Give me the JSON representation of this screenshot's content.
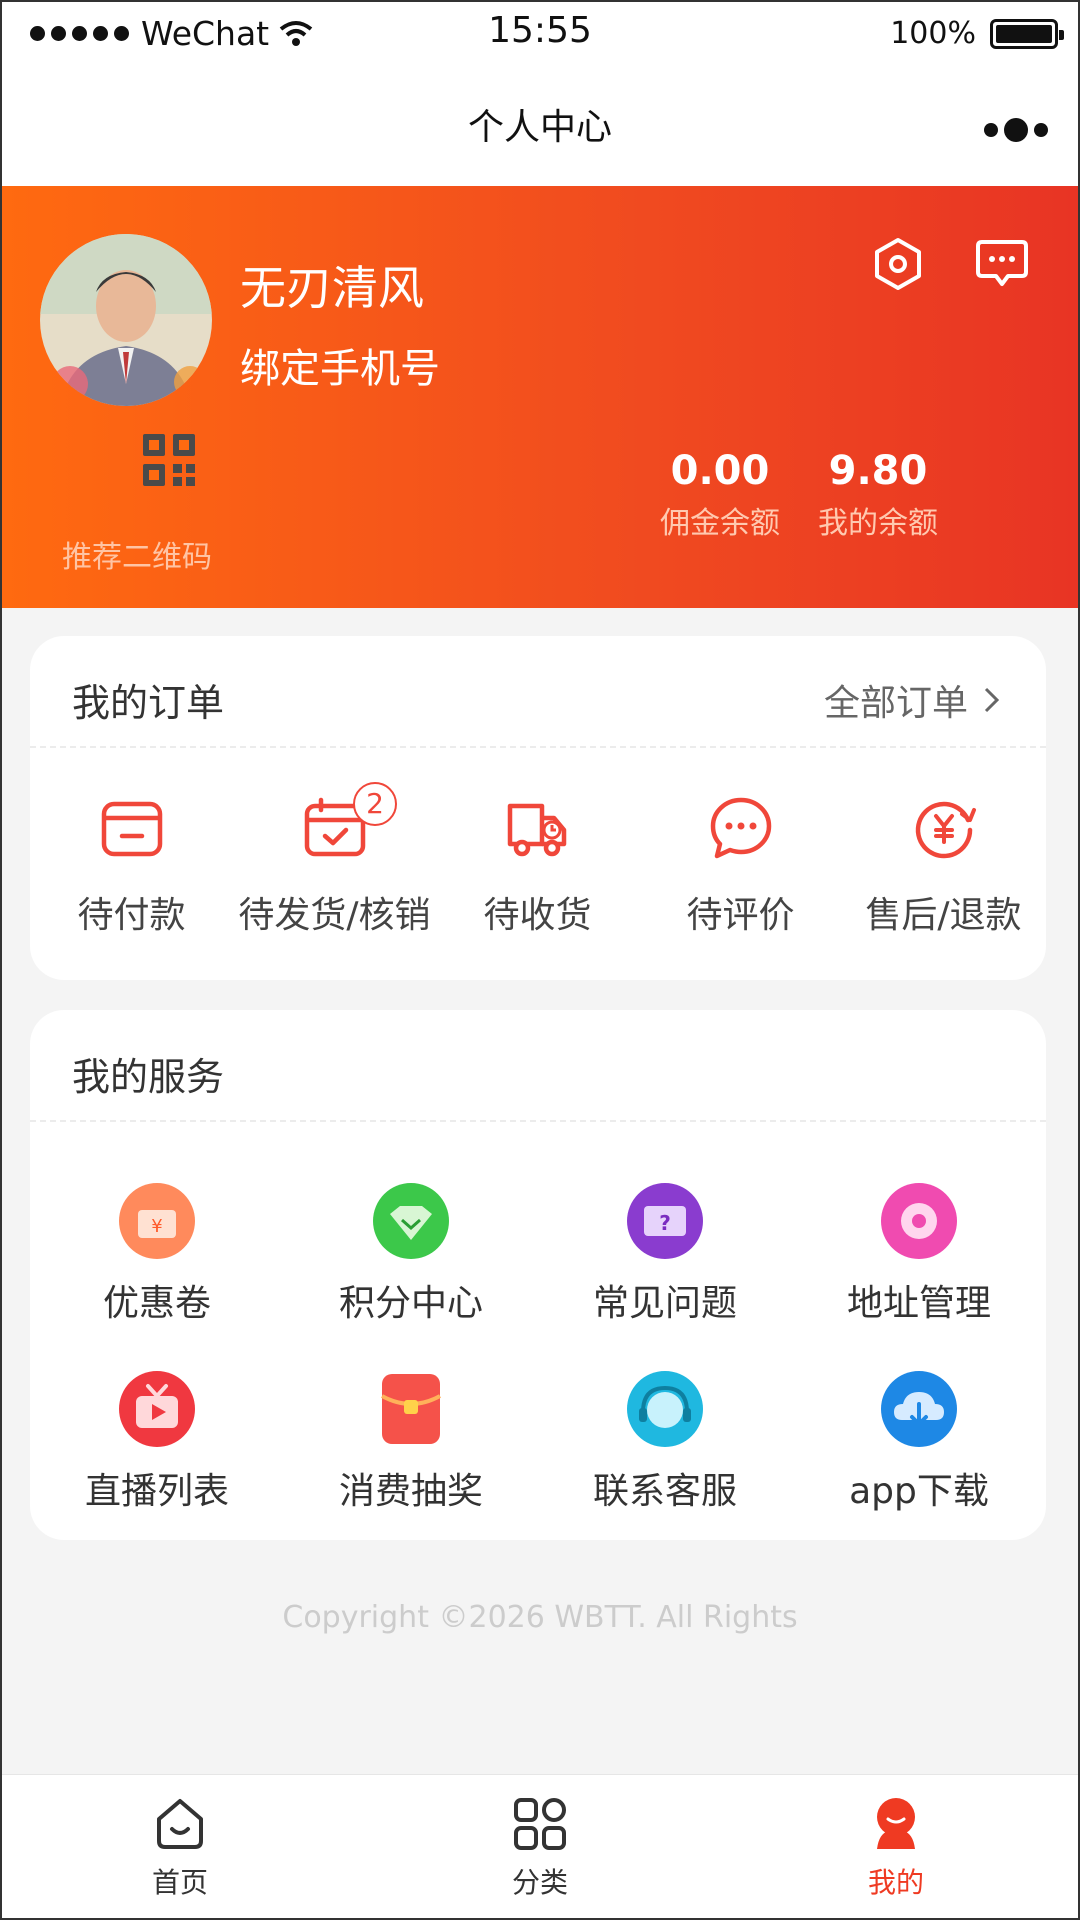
{
  "status_bar": {
    "carrier": "WeChat",
    "time": "15:55",
    "battery": "100%"
  },
  "nav": {
    "title": "个人中心"
  },
  "profile": {
    "username": "无刃清风",
    "bind_phone": "绑定手机号",
    "qr_label": "推荐二维码",
    "balances": [
      {
        "value": "0.00",
        "label": "佣金余额"
      },
      {
        "value": "9.80",
        "label": "我的余额"
      }
    ]
  },
  "orders": {
    "title": "我的订单",
    "more": "全部订单",
    "items": [
      {
        "label": "待付款",
        "icon": "wallet-icon"
      },
      {
        "label": "待发货/核销",
        "icon": "calendar-check-icon",
        "badge": "2"
      },
      {
        "label": "待收货",
        "icon": "delivery-truck-icon"
      },
      {
        "label": "待评价",
        "icon": "chat-bubble-icon"
      },
      {
        "label": "售后/退款",
        "icon": "refund-icon"
      }
    ]
  },
  "services": {
    "title": "我的服务",
    "items": [
      {
        "label": "优惠卷",
        "icon": "coupon-icon",
        "color": "#ff7a4a"
      },
      {
        "label": "积分中心",
        "icon": "points-icon",
        "color": "#3cc84a"
      },
      {
        "label": "常见问题",
        "icon": "faq-icon",
        "color": "#8a3ccf"
      },
      {
        "label": "地址管理",
        "icon": "location-icon",
        "color": "#f04bb0"
      },
      {
        "label": "直播列表",
        "icon": "live-tv-icon",
        "color": "#f03840"
      },
      {
        "label": "消费抽奖",
        "icon": "red-envelope-icon",
        "color": "#f5524a"
      },
      {
        "label": "联系客服",
        "icon": "headset-icon",
        "color": "#1fb8e0"
      },
      {
        "label": "app下载",
        "icon": "cloud-download-icon",
        "color": "#1e88e5"
      }
    ]
  },
  "copyright": "Copyright ©2026 WBTT. All Rights",
  "tabbar": {
    "items": [
      {
        "label": "首页",
        "icon": "home-icon"
      },
      {
        "label": "分类",
        "icon": "category-icon"
      },
      {
        "label": "我的",
        "icon": "profile-icon",
        "active": true
      }
    ]
  },
  "colors": {
    "accent": "#ef3a22",
    "header_start": "#ff6a10",
    "header_end": "#e83424"
  }
}
